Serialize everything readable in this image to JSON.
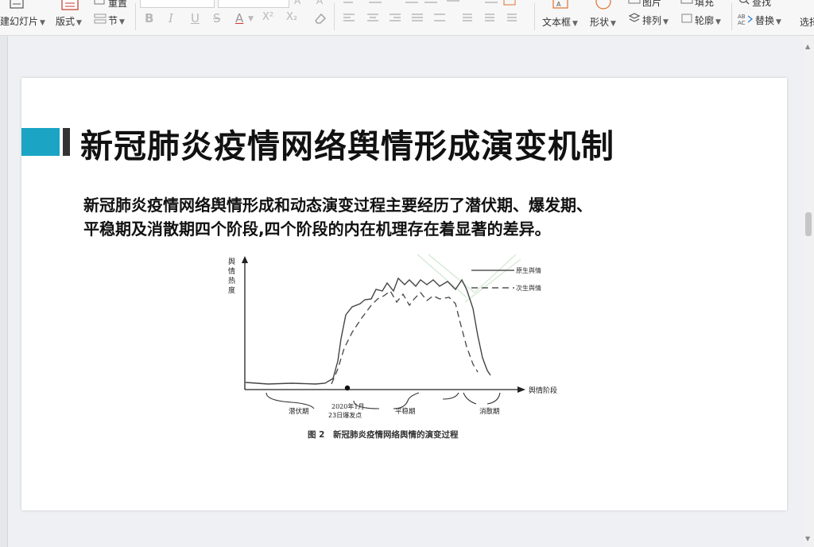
{
  "toolbar": {
    "new_slide_label": "建幻灯片",
    "layout_label": "版式",
    "section_label": "节",
    "reset_label": "重置",
    "textbox_label": "文本框",
    "shape_label": "形状",
    "image_label": "图片",
    "arrange_label": "排列",
    "fill_label": "填充",
    "outline_label": "轮廓",
    "find_label": "查找",
    "replace_label": "替换",
    "select_label": "选择"
  },
  "slide": {
    "title": "新冠肺炎疫情网络舆情形成演变机制",
    "body_line1": "新冠肺炎疫情网络舆情形成和动态演变过程主要经历了潜伏期、爆发期、",
    "body_line2": "平稳期及消散期四个阶段,四个阶段的内在机理存在着显著的差异。",
    "accent_color": "#1ba4c3"
  },
  "figure": {
    "y_label": [
      "舆",
      "情",
      "热",
      "度"
    ],
    "x_label": "舆情阶段",
    "legend_primary": "原生舆情",
    "legend_secondary": "次生舆情",
    "outbreak_line1": "2020年1月",
    "outbreak_line2": "23日爆发点",
    "stage_latent": "潜伏期",
    "stage_stable": "平稳期",
    "stage_dissipate": "消散期",
    "caption": "图 2　新冠肺炎疫情网络舆情的演变过程"
  }
}
